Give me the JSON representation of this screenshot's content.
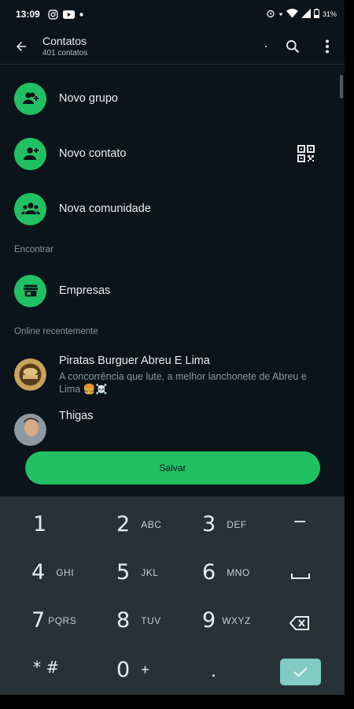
{
  "status_bar": {
    "time": "13:09",
    "battery": "31%"
  },
  "header": {
    "title": "Contatos",
    "subtitle": "401 contatos",
    "overflow_dot": "."
  },
  "actions": [
    {
      "label": "Novo grupo",
      "icon": "group-add-icon"
    },
    {
      "label": "Novo contato",
      "icon": "person-add-icon"
    },
    {
      "label": "Nova comunidade",
      "icon": "community-icon"
    }
  ],
  "sections": {
    "find": "Encontrar",
    "online": "Online recentemente"
  },
  "find_items": [
    {
      "label": "Empresas",
      "icon": "store-icon"
    }
  ],
  "contacts": [
    {
      "name": "Piratas Burguer Abreu E Lima",
      "status": "A concorrência que lute, a melhor lanchonete de Abreu e Lima 🍔☠️"
    },
    {
      "name": "Thigas",
      "status": ""
    }
  ],
  "save_button": "Salvar",
  "keypad": {
    "rows": [
      [
        {
          "num": "1",
          "letters": ""
        },
        {
          "num": "2",
          "letters": "ABC"
        },
        {
          "num": "3",
          "letters": "DEF"
        },
        {
          "num": "−",
          "letters": ""
        }
      ],
      [
        {
          "num": "4",
          "letters": "GHI"
        },
        {
          "num": "5",
          "letters": "JKL"
        },
        {
          "num": "6",
          "letters": "MNO"
        },
        {
          "num": "␣",
          "letters": ""
        }
      ],
      [
        {
          "num": "7",
          "letters": "PQRS"
        },
        {
          "num": "8",
          "letters": "TUV"
        },
        {
          "num": "9",
          "letters": "WXYZ"
        },
        {
          "num": "⌫",
          "letters": ""
        }
      ],
      [
        {
          "num": "* #",
          "letters": ""
        },
        {
          "num": "0",
          "letters": "+"
        },
        {
          "num": ".",
          "letters": ""
        },
        {
          "num": "✓",
          "letters": ""
        }
      ]
    ]
  },
  "colors": {
    "accent": "#21c063",
    "background": "#0b141a",
    "keypad": "#263238",
    "enter": "#80cbc4"
  }
}
